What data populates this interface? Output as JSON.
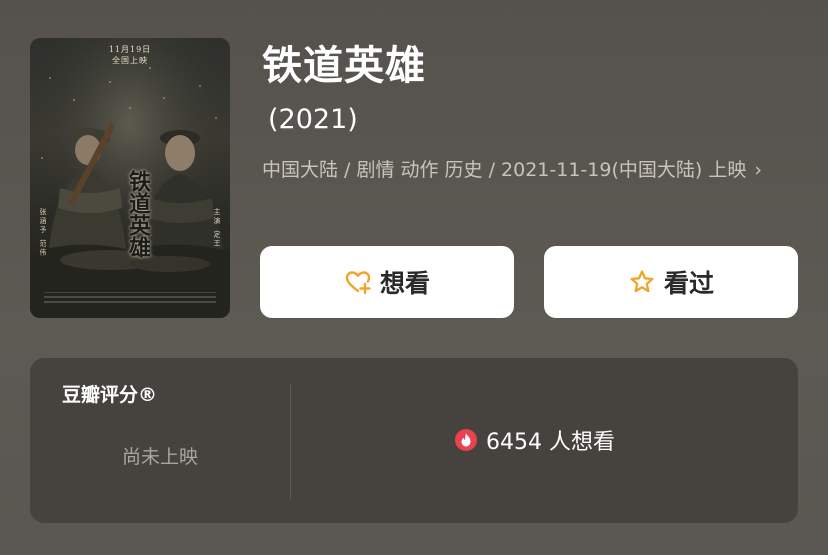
{
  "poster": {
    "date_line1": "11月19日",
    "date_line2": "全国上映",
    "title_art": "铁道英雄",
    "credit_left": "张涵予 范伟",
    "credit_right": "主演 定王"
  },
  "movie": {
    "title": "铁道英雄",
    "year": "(2021)",
    "meta": "中国大陆 / 剧情 动作 历史 / 2021-11-19(中国大陆) 上映",
    "meta_chevron": "›"
  },
  "actions": {
    "want_label": "想看",
    "seen_label": "看过",
    "want_icon": "heart-plus-icon",
    "seen_icon": "star-outline-icon",
    "accent": "#f0a52a"
  },
  "rating": {
    "title": "豆瓣评分®",
    "status": "尚未上映",
    "want_count": "6454 人想看",
    "fire_color": "#e8434f"
  }
}
